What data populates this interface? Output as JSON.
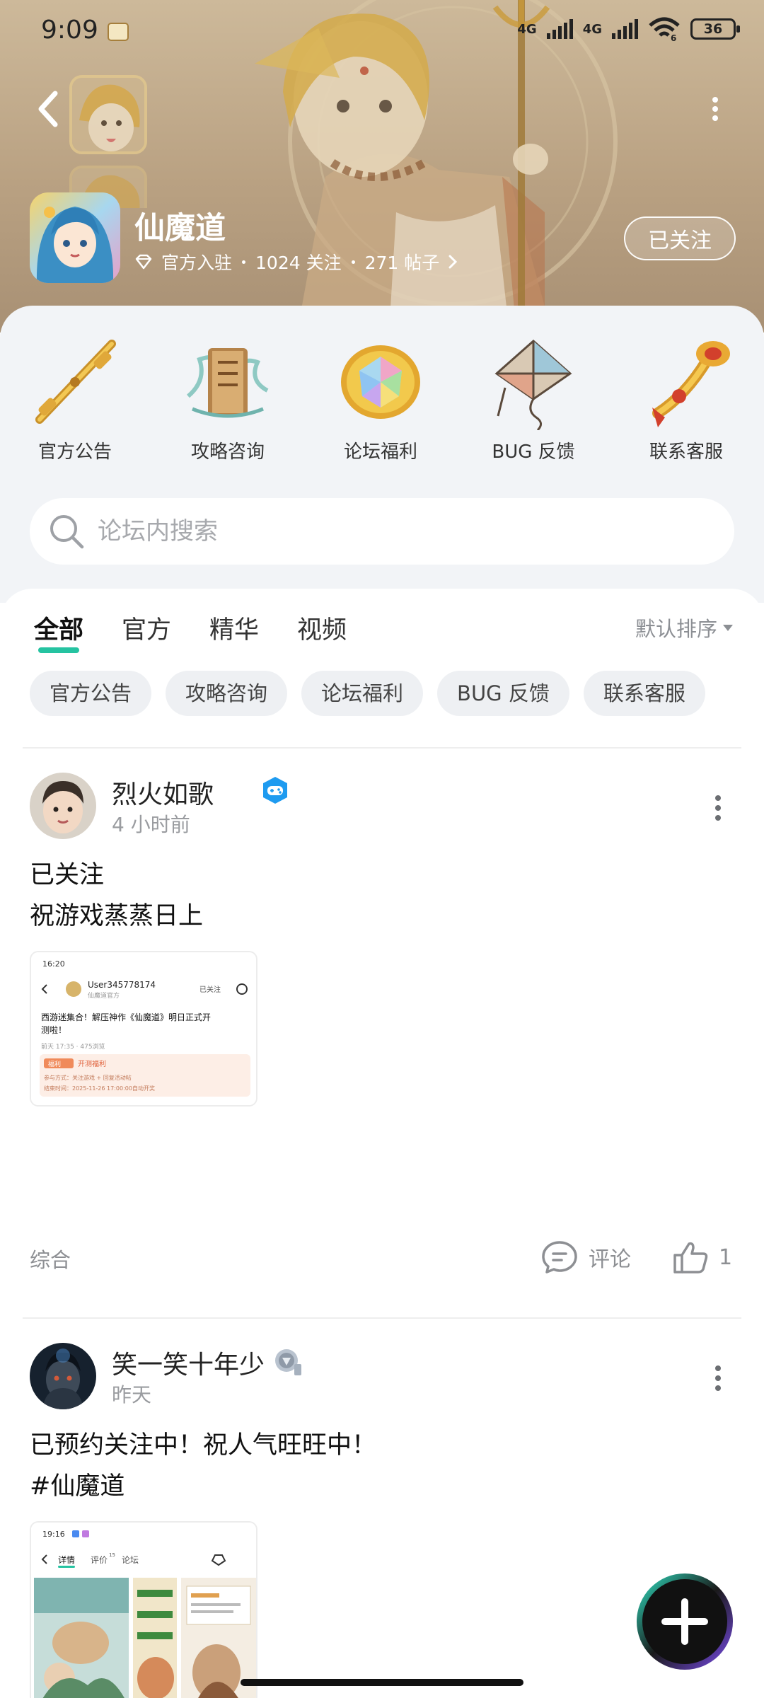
{
  "status_bar": {
    "time": "9:09",
    "network_1": "4G",
    "network_2": "4G",
    "wifi_label": "6",
    "battery": "36"
  },
  "game": {
    "title": "仙魔道",
    "official_label": "官方入驻",
    "followers": "1024 关注",
    "posts": "271 帖子",
    "follow_button": "已关注"
  },
  "shortcuts": [
    {
      "label": "官方公告"
    },
    {
      "label": "攻略咨询"
    },
    {
      "label": "论坛福利"
    },
    {
      "label": "BUG 反馈"
    },
    {
      "label": "联系客服"
    }
  ],
  "search": {
    "placeholder": "论坛内搜索"
  },
  "tabs": [
    {
      "label": "全部"
    },
    {
      "label": "官方"
    },
    {
      "label": "精华"
    },
    {
      "label": "视频"
    }
  ],
  "sort": {
    "label": "默认排序"
  },
  "chips": [
    {
      "label": "官方公告"
    },
    {
      "label": "攻略咨询"
    },
    {
      "label": "论坛福利"
    },
    {
      "label": "BUG 反馈"
    },
    {
      "label": "联系客服"
    }
  ],
  "posts": [
    {
      "author": "烈火如歌",
      "time": "4 小时前",
      "lines": [
        "已关注",
        "祝游戏蒸蒸日上"
      ],
      "category": "综合",
      "comment_label": "评论",
      "like_count": "1",
      "image": {
        "time": "16:20",
        "user": "User345778174",
        "user_sub": "仙魔道官方",
        "follow": "已关注",
        "title_line1": "西游迷集合！解压神作《仙魔道》明日正式开",
        "title_line2": "测啦！",
        "meta": "前天 17:35 · 475浏览",
        "benefit_tag": "福利",
        "benefit_title": "开测福利",
        "benefit_line1": "参与方式：关注游戏 + 回复活动帖",
        "benefit_line2": "结束时间：2025-11-26 17:00:00自动开奖"
      }
    },
    {
      "author": "笑一笑十年少",
      "time": "昨天",
      "lines": [
        "已预约关注中！祝人气旺旺中！",
        "#仙魔道"
      ],
      "image": {
        "time": "19:16",
        "tab_detail": "详情",
        "tab_review": "评价",
        "tab_review_count": "15",
        "tab_forum": "论坛"
      }
    }
  ],
  "colors": {
    "accent": "#25c3a1",
    "badge_blue": "#1e9bf0",
    "header": "#b9a182",
    "page_bg": "#f2f4f7"
  }
}
